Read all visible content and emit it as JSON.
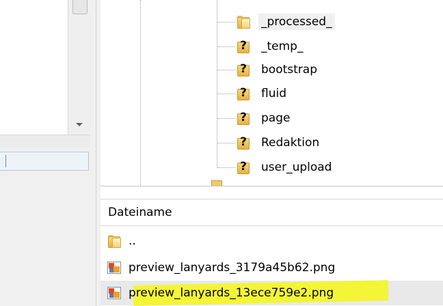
{
  "tree": {
    "items": [
      {
        "label": "_processed_",
        "icon": "folder-icon",
        "selected": true
      },
      {
        "label": "_temp_",
        "icon": "unknown-folder-icon"
      },
      {
        "label": "bootstrap",
        "icon": "unknown-folder-icon"
      },
      {
        "label": "fluid",
        "icon": "unknown-folder-icon"
      },
      {
        "label": "page",
        "icon": "unknown-folder-icon"
      },
      {
        "label": "Redaktion",
        "icon": "unknown-folder-icon"
      },
      {
        "label": "user_upload",
        "icon": "unknown-folder-icon"
      }
    ],
    "question_glyph": "?"
  },
  "file_list": {
    "column_header": "Dateiname",
    "rows": [
      {
        "label": "..",
        "icon": "folder-icon"
      },
      {
        "label": "preview_lanyards_3179a45b62.png",
        "icon": "image-file-icon"
      },
      {
        "label": "preview_lanyards_13ece759e2.png",
        "icon": "image-file-icon",
        "selected": true,
        "highlighted": true
      }
    ]
  },
  "colors": {
    "highlight": "#f3f536",
    "folder": "#e7b13f",
    "selection": "#e9e9e9"
  }
}
